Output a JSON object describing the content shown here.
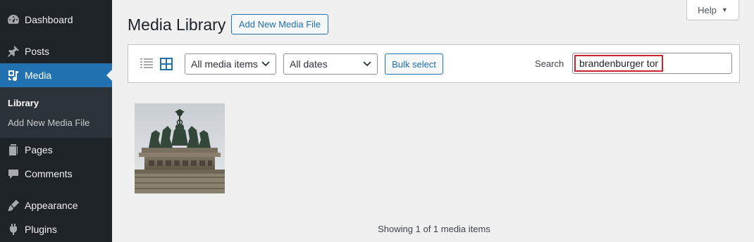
{
  "sidebar": {
    "items": [
      {
        "label": "Dashboard",
        "icon": "dashboard-icon"
      },
      {
        "label": "Posts",
        "icon": "pin-icon"
      },
      {
        "label": "Media",
        "icon": "media-icon",
        "active": true
      },
      {
        "label": "Pages",
        "icon": "pages-icon"
      },
      {
        "label": "Comments",
        "icon": "comments-icon"
      },
      {
        "label": "Appearance",
        "icon": "brush-icon"
      },
      {
        "label": "Plugins",
        "icon": "plug-icon"
      }
    ],
    "submenu": [
      {
        "label": "Library",
        "current": true
      },
      {
        "label": "Add New Media File"
      }
    ]
  },
  "header": {
    "title": "Media Library",
    "add_new_label": "Add New Media File",
    "help_label": "Help"
  },
  "toolbar": {
    "type_filter": "All media items",
    "date_filter": "All dates",
    "bulk_select_label": "Bulk select",
    "search_label": "Search",
    "search_value": "brandenburger tor"
  },
  "status_text": "Showing 1 of 1 media items",
  "colors": {
    "sidebar_bg": "#1d2327",
    "accent": "#2271b1",
    "highlight_border": "#c9262b"
  }
}
